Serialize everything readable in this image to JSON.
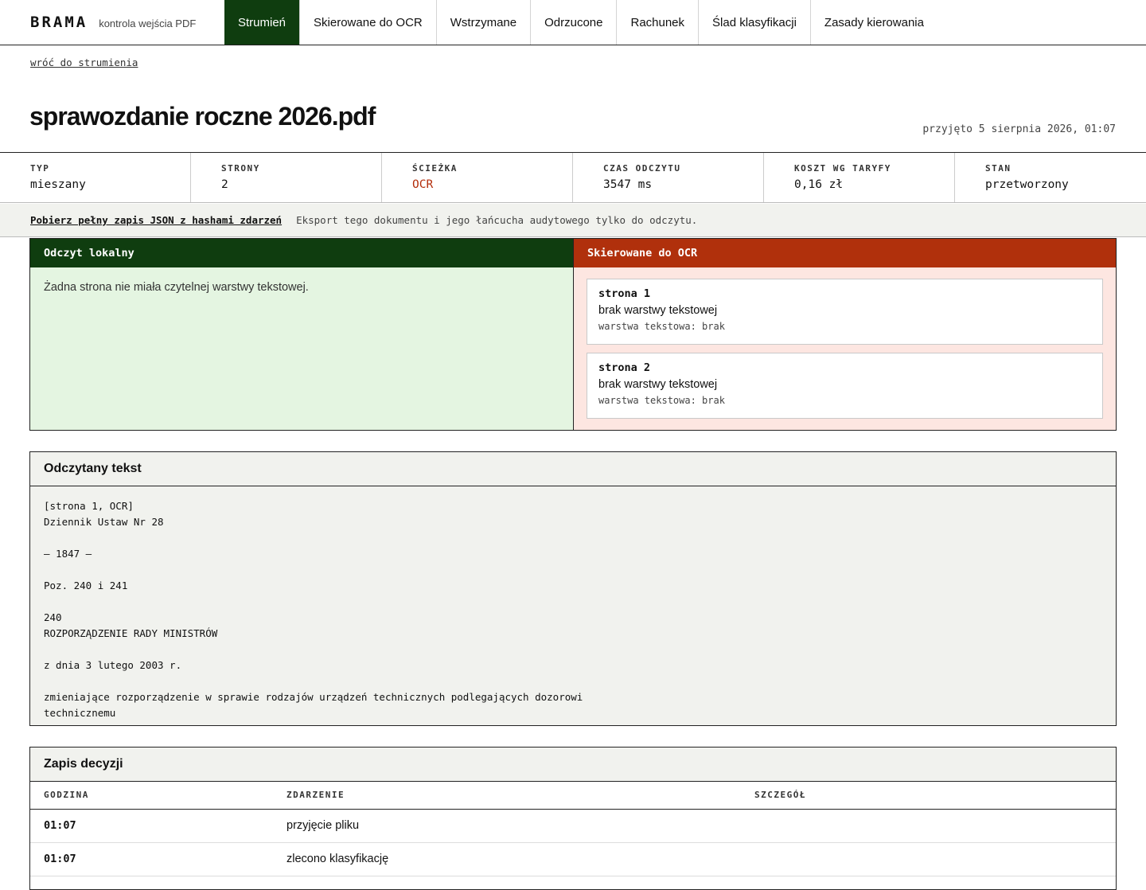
{
  "brand": {
    "name": "BRAMA",
    "subtitle": "kontrola wejścia PDF"
  },
  "nav": {
    "items": [
      {
        "label": "Strumień",
        "active": true
      },
      {
        "label": "Skierowane do OCR",
        "active": false
      },
      {
        "label": "Wstrzymane",
        "active": false
      },
      {
        "label": "Odrzucone",
        "active": false
      },
      {
        "label": "Rachunek",
        "active": false
      },
      {
        "label": "Ślad klasyfikacji",
        "active": false
      },
      {
        "label": "Zasady kierowania",
        "active": false
      }
    ]
  },
  "back_link": "wróć do strumienia",
  "document": {
    "title": "sprawozdanie roczne 2026.pdf",
    "received": "przyjęto 5 sierpnia 2026, 01:07"
  },
  "stats": [
    {
      "label": "TYP",
      "value": "mieszany"
    },
    {
      "label": "STRONY",
      "value": "2"
    },
    {
      "label": "ŚCIEŻKA",
      "value": "OCR"
    },
    {
      "label": "CZAS ODCZYTU",
      "value": "3547 ms"
    },
    {
      "label": "KOSZT WG TARYFY",
      "value": "0,16 zł"
    },
    {
      "label": "STAN",
      "value": "przetworzony"
    }
  ],
  "export": {
    "link_label": "Pobierz pełny zapis JSON z hashami zdarzeń",
    "note": "Eksport tego dokumentu i jego łańcucha audytowego tylko do odczytu."
  },
  "local_panel": {
    "heading": "Odczyt lokalny",
    "message": "Żadna strona nie miała czytelnej warstwy tekstowej."
  },
  "ocr_panel": {
    "heading": "Skierowane do OCR",
    "pages": [
      {
        "title": "strona 1",
        "reason": "brak warstwy tekstowej",
        "meta": "warstwa tekstowa: brak"
      },
      {
        "title": "strona 2",
        "reason": "brak warstwy tekstowej",
        "meta": "warstwa tekstowa: brak"
      }
    ]
  },
  "text_section": {
    "heading": "Odczytany tekst",
    "content": "[strona 1, OCR]\nDziennik Ustaw Nr 28\n\n— 1847 —\n\nPoz. 240 i 241\n\n240\nROZPORZĄDZENIE RADY MINISTRÓW\n\nz dnia 3 lutego 2003 r.\n\nzmieniające rozporządzenie w sprawie rodzajów urządzeń technicznych podlegających dozorowi\ntechnicznemu"
  },
  "decisions": {
    "heading": "Zapis decyzji",
    "columns": [
      "GODZINA",
      "ZDARZENIE",
      "SZCZEGÓŁ"
    ],
    "rows": [
      {
        "time": "01:07",
        "event": "przyjęcie pliku",
        "detail": ""
      },
      {
        "time": "01:07",
        "event": "zlecono klasyfikację",
        "detail": ""
      }
    ]
  },
  "colors": {
    "nav_active": "#0f3d0f",
    "local_panel_bg": "#e4f5e1",
    "ocr_accent": "#b0300c",
    "ocr_panel_bg": "#fde6e1"
  }
}
